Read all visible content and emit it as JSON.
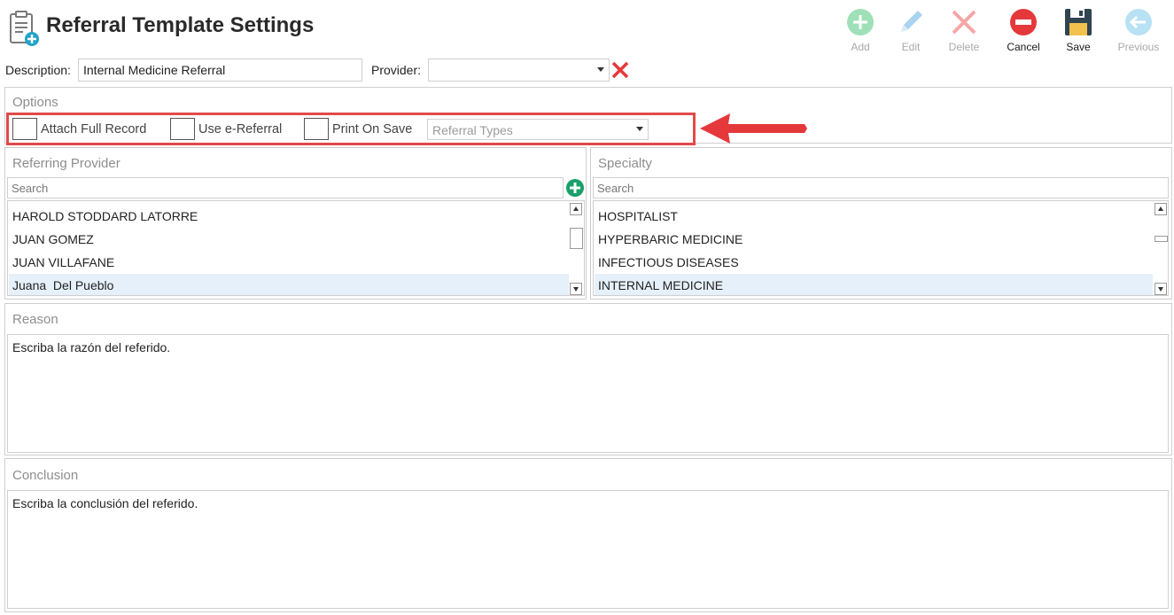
{
  "header": {
    "title": "Referral Template Settings",
    "icon": "clipboard-add-icon"
  },
  "toolbar": {
    "add": {
      "label": "Add",
      "icon": "plus-circle-icon",
      "color": "#9fe0b8"
    },
    "edit": {
      "label": "Edit",
      "icon": "pencil-icon",
      "color": "#a9d3f0"
    },
    "delete": {
      "label": "Delete",
      "icon": "x-icon",
      "color": "#f6a6a6"
    },
    "cancel": {
      "label": "Cancel",
      "icon": "minus-circle-icon",
      "color": "#e5383b"
    },
    "save": {
      "label": "Save",
      "icon": "floppy-disk-icon",
      "color": "#2f4550"
    },
    "previous": {
      "label": "Previous",
      "icon": "arrow-left-circle-icon",
      "color": "#b8e2f4"
    }
  },
  "form": {
    "description_label": "Description:",
    "description_value": "Internal Medicine Referral",
    "provider_label": "Provider:",
    "provider_value": "",
    "clear_icon": "red-x-icon"
  },
  "options": {
    "title": "Options",
    "attach_full_record": "Attach Full Record",
    "use_e_referral": "Use e-Referral",
    "print_on_save": "Print On Save",
    "referral_types_placeholder": "Referral Types"
  },
  "referring_provider": {
    "title": "Referring Provider",
    "search_placeholder": "Search",
    "items": [
      {
        "label": "HAROLD STODDARD LATORRE"
      },
      {
        "label": "JUAN GOMEZ"
      },
      {
        "label": "JUAN VILLAFANE"
      },
      {
        "label": "Juana  Del Pueblo",
        "selected": true
      }
    ]
  },
  "specialty": {
    "title": "Specialty",
    "search_placeholder": "Search",
    "items": [
      {
        "label": "HOSPITALIST"
      },
      {
        "label": "HYPERBARIC MEDICINE"
      },
      {
        "label": "INFECTIOUS DISEASES"
      },
      {
        "label": "INTERNAL MEDICINE",
        "selected": true
      }
    ]
  },
  "reason": {
    "title": "Reason",
    "value": "Escriba la razón del referido."
  },
  "conclusion": {
    "title": "Conclusion",
    "value": "Escriba la conclusión del referido."
  },
  "colors": {
    "accent_red": "#e24a4a",
    "selected_row": "#e6f0fa",
    "add_provider_green": "#1aa06a"
  }
}
